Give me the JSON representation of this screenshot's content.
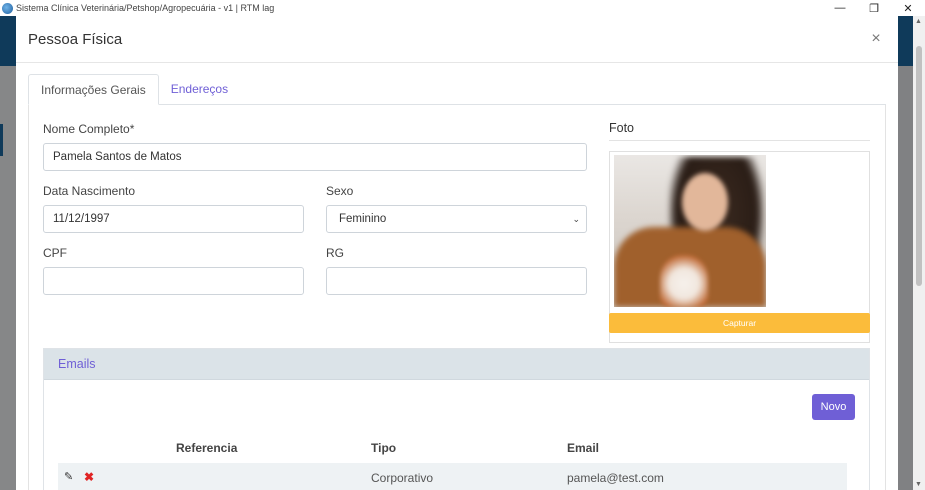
{
  "window": {
    "title": "Sistema Clínica Veterinária/Petshop/Agropecuária - v1 | RTM lag",
    "minimize": "—",
    "restore": "❐",
    "close": "✕"
  },
  "modal": {
    "title": "Pessoa Física",
    "close": "×",
    "tabs": [
      {
        "label": "Informações Gerais"
      },
      {
        "label": "Endereços"
      }
    ]
  },
  "form": {
    "nome_label": "Nome Completo*",
    "nome_value": "Pamela Santos de Matos",
    "nascimento_label": "Data Nascimento",
    "nascimento_value": "11/12/1997",
    "sexo_label": "Sexo",
    "sexo_value": "Feminino",
    "cpf_label": "CPF",
    "cpf_value": "",
    "rg_label": "RG",
    "rg_value": ""
  },
  "foto": {
    "title": "Foto",
    "capture_label": "Capturar"
  },
  "emails": {
    "title": "Emails",
    "novo_label": "Novo",
    "columns": [
      "Referencia",
      "Tipo",
      "Email"
    ],
    "rows": [
      {
        "referencia": "",
        "tipo": "Corporativo",
        "email": "pamela@test.com"
      }
    ]
  },
  "colors": {
    "accent": "#6f5fd6",
    "capture": "#fbbc3b",
    "delete": "#e02424",
    "topbar": "#1c6aa5"
  }
}
